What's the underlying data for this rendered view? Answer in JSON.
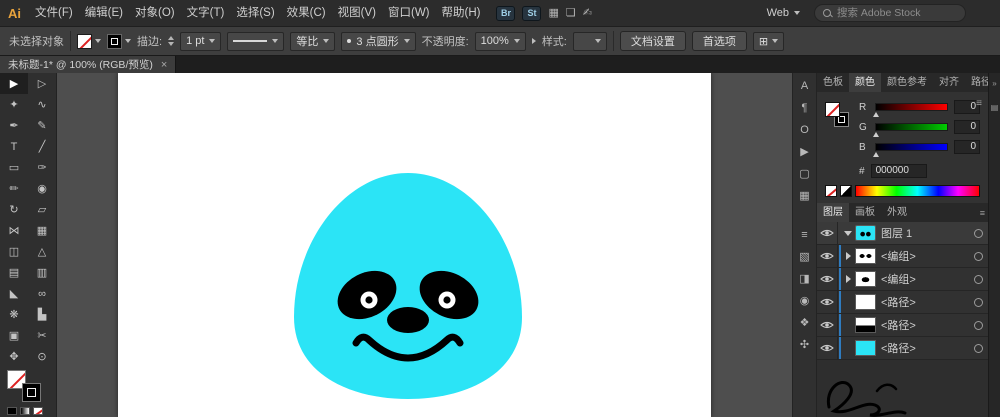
{
  "app": {
    "logo": "Ai"
  },
  "menubar": {
    "items": [
      "文件(F)",
      "编辑(E)",
      "对象(O)",
      "文字(T)",
      "选择(S)",
      "效果(C)",
      "视图(V)",
      "窗口(W)",
      "帮助(H)"
    ]
  },
  "topbar": {
    "icons": [
      {
        "name": "bridge",
        "glyph": "Br"
      },
      {
        "name": "stock",
        "glyph": "St"
      },
      {
        "name": "arrange-documents",
        "glyph": "▦"
      },
      {
        "name": "document-layout",
        "glyph": "❏"
      },
      {
        "name": "touch-workspace",
        "glyph": "✍"
      }
    ],
    "workspace": "Web",
    "search_placeholder": "搜索 Adobe Stock"
  },
  "controlbar": {
    "status": "未选择对象",
    "stroke_label": "描边:",
    "stroke_value": "1 pt",
    "profile_value": "等比",
    "brush_value": "3 点圆形",
    "opacity_label": "不透明度:",
    "opacity_value": "100%",
    "style_label": "样式:",
    "doc_setup_label": "文档设置",
    "preferences_label": "首选项",
    "align_icon": "⊞"
  },
  "document_tab": {
    "title": "未标题-1* @ 100% (RGB/预览)",
    "close_icon": "×"
  },
  "tools": [
    {
      "name": "selection-tool",
      "glyph": "▶"
    },
    {
      "name": "direct-selection-tool",
      "glyph": "▷"
    },
    {
      "name": "magic-wand-tool",
      "glyph": "✦"
    },
    {
      "name": "lasso-tool",
      "glyph": "∿"
    },
    {
      "name": "pen-tool",
      "glyph": "✒"
    },
    {
      "name": "curvature-tool",
      "glyph": "✎"
    },
    {
      "name": "type-tool",
      "glyph": "T"
    },
    {
      "name": "line-segment-tool",
      "glyph": "╱"
    },
    {
      "name": "rectangle-tool",
      "glyph": "▭"
    },
    {
      "name": "paintbrush-tool",
      "glyph": "✑"
    },
    {
      "name": "pencil-tool",
      "glyph": "✏"
    },
    {
      "name": "shaper-tool",
      "glyph": "◉"
    },
    {
      "name": "rotate-tool",
      "glyph": "↻"
    },
    {
      "name": "scale-tool",
      "glyph": "▱"
    },
    {
      "name": "width-tool",
      "glyph": "⋈"
    },
    {
      "name": "free-transform-tool",
      "glyph": "▦"
    },
    {
      "name": "shape-builder-tool",
      "glyph": "◫"
    },
    {
      "name": "perspective-grid-tool",
      "glyph": "△"
    },
    {
      "name": "mesh-tool",
      "glyph": "▤"
    },
    {
      "name": "gradient-tool",
      "glyph": "▥"
    },
    {
      "name": "eyedropper-tool",
      "glyph": "◣"
    },
    {
      "name": "blend-tool",
      "glyph": "∞"
    },
    {
      "name": "symbol-sprayer-tool",
      "glyph": "❋"
    },
    {
      "name": "column-graph-tool",
      "glyph": "▙"
    },
    {
      "name": "artboard-tool",
      "glyph": "▣"
    },
    {
      "name": "slice-tool",
      "glyph": "✂"
    },
    {
      "name": "hand-tool",
      "glyph": "✥"
    },
    {
      "name": "zoom-tool",
      "glyph": "⊙"
    }
  ],
  "panel_strip": [
    {
      "name": "character-panel",
      "glyph": "A"
    },
    {
      "name": "paragraph-panel",
      "glyph": "¶"
    },
    {
      "name": "opentype-panel",
      "glyph": "O"
    },
    {
      "name": "actions-panel",
      "glyph": "▶"
    },
    {
      "name": "artboards-panel",
      "glyph": "▢"
    },
    {
      "name": "transform-panel",
      "glyph": "▦"
    },
    {
      "name": "stroke-panel",
      "glyph": "≡"
    },
    {
      "name": "gradient-panel",
      "glyph": "▧"
    },
    {
      "name": "transparency-panel",
      "glyph": "◨"
    },
    {
      "name": "appearance-panel",
      "glyph": "◉"
    },
    {
      "name": "graphic-styles-panel",
      "glyph": "❖"
    },
    {
      "name": "symbols-panel",
      "glyph": "✣"
    }
  ],
  "panels": {
    "top_tabs": [
      "色板",
      "颜色",
      "颜色参考",
      "对齐",
      "路径查找器"
    ],
    "panel_grid_icon": "▦",
    "panel_menu_icon": "≡",
    "color": {
      "channels": [
        {
          "label": "R",
          "value": "0"
        },
        {
          "label": "G",
          "value": "0"
        },
        {
          "label": "B",
          "value": "0"
        }
      ],
      "hex_prefix": "#",
      "hex_value": "000000"
    },
    "bottom_tabs": [
      "图层",
      "画板",
      "外观"
    ],
    "layers": [
      {
        "name": "图层 1"
      },
      {
        "name": "<编组>"
      },
      {
        "name": "<编组>"
      },
      {
        "name": "<路径>"
      },
      {
        "name": "<路径>"
      },
      {
        "name": "<路径>"
      }
    ]
  },
  "right_strip": {
    "collapse_icon": "»",
    "dock_icon": "▤"
  },
  "artwork": {
    "colors": {
      "cyan": "#2be4f6",
      "black": "#000000",
      "white": "#ffffff"
    }
  }
}
